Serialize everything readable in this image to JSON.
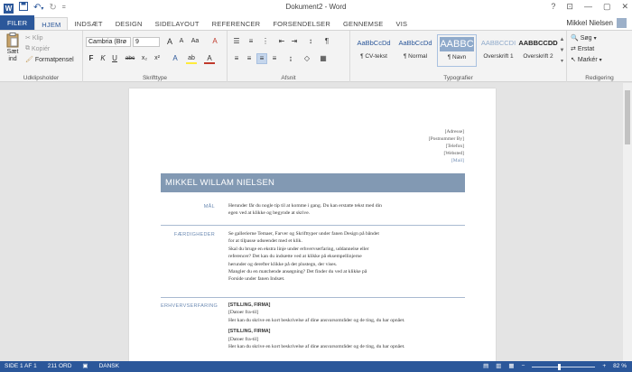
{
  "title_bar": {
    "title": "Dokument2 - Word",
    "help": "?",
    "minimize": "—",
    "restore": "▢",
    "close": "✕"
  },
  "tabs": [
    "FILER",
    "HJEM",
    "INDSÆT",
    "DESIGN",
    "SIDELAYOUT",
    "REFERENCER",
    "FORSENDELSER",
    "GENNEMSE",
    "VIS"
  ],
  "user": {
    "name": "Mikkel Nielsen"
  },
  "ribbon": {
    "clipboard": {
      "label": "Udklipsholder",
      "paste_top": "Sæt",
      "paste_bottom": "ind",
      "cut": "Klip",
      "copy": "Kopiér",
      "format_painter": "Formatpensel"
    },
    "font": {
      "label": "Skrifttype",
      "font_name": "Cambria (Brø",
      "font_size": "9",
      "grow": "A",
      "shrink": "A",
      "case": "Aa",
      "clear": "A",
      "bold": "F",
      "italic": "K",
      "underline": "U",
      "strike": "abc",
      "sub": "x₂",
      "sup": "x²",
      "effects": "A",
      "highlight": "ab",
      "color": "A"
    },
    "paragraph": {
      "label": "Afsnit",
      "show_marks": "¶"
    },
    "styles": {
      "label": "Typografier",
      "items": [
        {
          "preview": "AaBbCcDd",
          "name": "¶ CV-tekst"
        },
        {
          "preview": "AaBbCcDd",
          "name": "¶ Normal"
        },
        {
          "preview": "AABBC",
          "name": "¶ Navn"
        },
        {
          "preview": "AABBCCDI",
          "name": "Overskrift 1"
        },
        {
          "preview": "AABBCCDD",
          "name": "Overskrift 2"
        }
      ]
    },
    "editing": {
      "label": "Redigering",
      "find": "Søg",
      "replace": "Erstat",
      "select": "Markér"
    }
  },
  "document": {
    "contact": [
      "[Adresse]",
      "[Postnummer By]",
      "[Telefon]",
      "[Websted]",
      "[Mail]"
    ],
    "name": "MIKKEL WILLAM NIELSEN",
    "sections": {
      "goal_label": "MÅL",
      "goal_lines": [
        "Herunder får du nogle tip til at komme i gang. Du kan erstatte tekst med din",
        "egen ved at klikke og begynde at skrive."
      ],
      "skills_label": "FÆRDIGHEDER",
      "skills_lines": [
        "Se gallerierne Temaer, Farver og Skrifttyper under fanen Design på båndet",
        "for at tilpasse udseendet med et klik.",
        "Skal du bruge en ekstra linje under erhvervserfaring, uddannelse eller",
        "referencer? Det kan du indsætte ved at klikke på eksempellinjerne",
        "herunder og derefter klikke på det plustegn, der vises.",
        "Mangler du en matchende ansøgning? Det finder du ved at klikke på",
        "Forside under fanen Indsæt."
      ],
      "experience_label": "ERHVERVSERFARING",
      "jobs": [
        {
          "title": "[STILLING, FIRMA]",
          "dates": "[Datoer fra-til]",
          "desc": "Her kan du skrive en kort beskrivelse af dine ansvarsområder og de ting, du har opnået."
        },
        {
          "title": "[STILLING, FIRMA]",
          "dates": "[Datoer fra-til]",
          "desc": "Her kan du skrive en kort beskrivelse af dine ansvarsområder og de ting, du har opnået."
        }
      ]
    }
  },
  "status_bar": {
    "page": "SIDE 1 AF 1",
    "words": "211 ORD",
    "language": "DANSK",
    "zoom": "82 %",
    "zoom_level": 0.82
  },
  "colors": {
    "brand": "#2b579a",
    "name_bar": "#8299b3",
    "section_label": "#6d8bb3"
  }
}
